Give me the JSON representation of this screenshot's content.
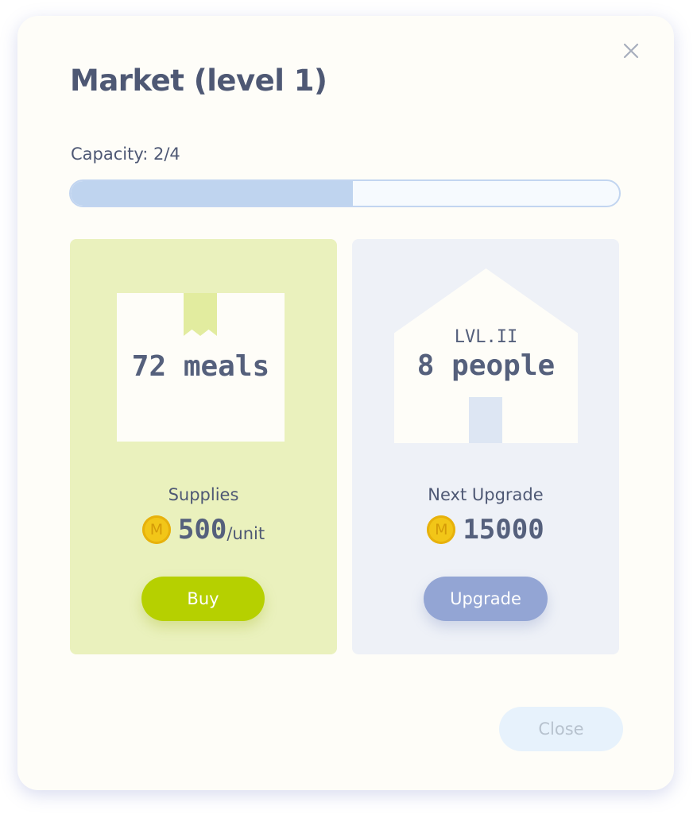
{
  "modal": {
    "title": "Market (level 1)",
    "close_icon": "close-icon"
  },
  "capacity": {
    "label": "Capacity: 2/4",
    "fraction": 0.515
  },
  "supplies_card": {
    "stock_text": "72 meals",
    "label": "Supplies",
    "price": "500",
    "price_unit": "/unit",
    "coin_letter": "M",
    "button_label": "Buy"
  },
  "upgrade_card": {
    "level_text": "LVL.II",
    "capacity_text": "8 people",
    "label": "Next Upgrade",
    "price": "15000",
    "coin_letter": "M",
    "button_label": "Upgrade"
  },
  "footer": {
    "close_label": "Close"
  },
  "colors": {
    "title_text": "#4e5874",
    "progress_fill": "#bfd4ef",
    "supplies_card_bg": "#eaf1bd",
    "upgrade_card_bg": "#eef1f7",
    "buy_button": "#b6d000",
    "upgrade_button": "#93a5d4",
    "coin": "#f2c618"
  }
}
